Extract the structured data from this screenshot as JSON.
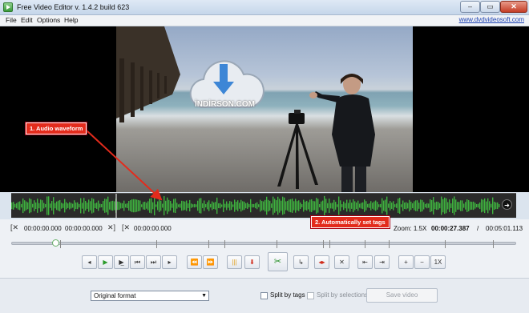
{
  "window": {
    "title": "Free Video Editor v. 1.4.2 build 623",
    "minimize_glyph": "–",
    "maximize_glyph": "▭",
    "close_glyph": "✕"
  },
  "menu": {
    "items": [
      "File",
      "Edit",
      "Options",
      "Help"
    ],
    "site_link": "www.dvdvideosoft.com"
  },
  "watermark": "İNDİRSON.COM",
  "callouts": {
    "audio": "1. Audio waveform",
    "tags": "2. Automatically set tags"
  },
  "times": {
    "start_a": "00:00:00.000",
    "end_a": "00:00:00.000",
    "start_b": "00:00:00.000",
    "zoom": "Zoom:  1.5X",
    "current": "00:00:27.387",
    "separator": "/",
    "total": "00:05:01.113"
  },
  "timeline": {
    "position_fraction": 0.086
  },
  "toolbar": {
    "buttons": [
      {
        "name": "prev-frame-button",
        "glyph": "◂",
        "icon": "step-back-icon"
      },
      {
        "name": "play-button",
        "glyph": "▶",
        "icon": "play-icon"
      },
      {
        "name": "play-selection-button",
        "glyph": "▶̲",
        "icon": "play-selection-icon"
      },
      {
        "name": "go-start-button",
        "glyph": "⏮",
        "icon": "skip-start-icon"
      },
      {
        "name": "go-end-button",
        "glyph": "⏭",
        "icon": "skip-end-icon"
      },
      {
        "name": "next-frame-button",
        "glyph": "▸",
        "icon": "step-forward-icon"
      },
      {
        "name": "prev-marker-button",
        "glyph": "⏪",
        "icon": "prev-marker-icon"
      },
      {
        "name": "next-marker-button",
        "glyph": "⏩",
        "icon": "next-marker-icon"
      },
      {
        "name": "auto-tags-button",
        "glyph": "|||",
        "icon": "tags-icon"
      },
      {
        "name": "download-button",
        "glyph": "⬇",
        "icon": "download-icon"
      },
      {
        "name": "cut-button",
        "glyph": "✂",
        "icon": "scissors-icon"
      },
      {
        "name": "rotate-button",
        "glyph": "↳",
        "icon": "rotate-icon"
      },
      {
        "name": "mark-selection-button",
        "glyph": "◂▸",
        "icon": "selection-icon"
      },
      {
        "name": "delete-button",
        "glyph": "✕",
        "icon": "delete-icon"
      },
      {
        "name": "seek-start-button",
        "glyph": "⇤",
        "icon": "seek-start-icon"
      },
      {
        "name": "seek-end-button",
        "glyph": "⇥",
        "icon": "seek-end-icon"
      },
      {
        "name": "zoom-in-button",
        "glyph": "+",
        "icon": "zoom-in-icon"
      },
      {
        "name": "zoom-out-button",
        "glyph": "−",
        "icon": "zoom-out-icon"
      },
      {
        "name": "zoom-reset-button",
        "glyph": "1X",
        "icon": "zoom-reset-icon"
      }
    ]
  },
  "bottom": {
    "format_selected": "Original format",
    "split_by_tags": "Split by tags",
    "split_by_selections": "Split by selections",
    "save_button": "Save video"
  },
  "colors": {
    "callout": "#e32b1c",
    "waveform": "#3fb23f",
    "titlebar": "#c5d6ea"
  }
}
